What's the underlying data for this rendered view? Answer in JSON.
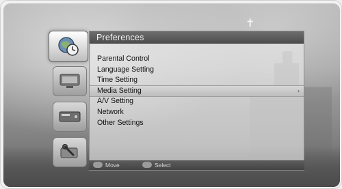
{
  "panel": {
    "title": "Preferences"
  },
  "menu": {
    "items": [
      {
        "label": "Parental Control"
      },
      {
        "label": "Language Setting"
      },
      {
        "label": "Time Setting"
      },
      {
        "label": "Media Setting",
        "selected": true
      },
      {
        "label": "A/V Setting"
      },
      {
        "label": "Network"
      },
      {
        "label": "Other Settings"
      }
    ],
    "selected_arrow": "›"
  },
  "hints": {
    "move_label": "Move",
    "select_label": "Select"
  },
  "rail": {
    "items": [
      {
        "icon": "preferences-clock-icon",
        "active": true
      },
      {
        "icon": "media-icon"
      },
      {
        "icon": "tv-receiver-icon"
      },
      {
        "icon": "tools-icon"
      }
    ]
  },
  "background": {
    "cross_glyph": "✝"
  },
  "colors": {
    "title_bar": "#5a5a5a",
    "selected_row": "#c8c8c8",
    "text": "#111111"
  }
}
